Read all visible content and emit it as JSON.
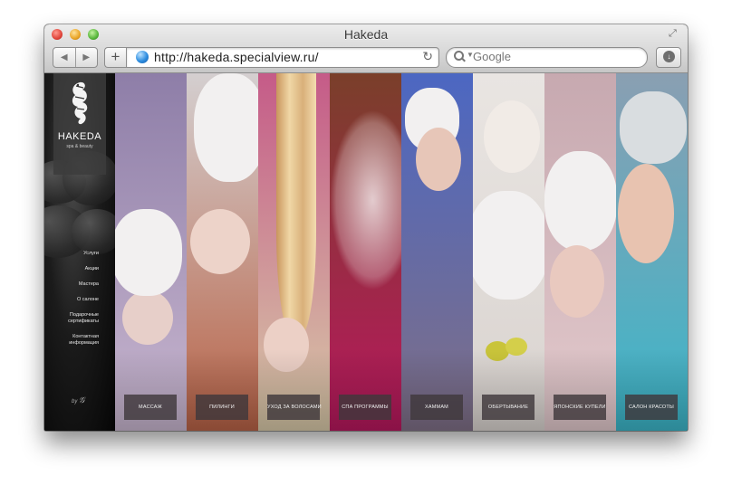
{
  "window": {
    "title": "Hakeda"
  },
  "toolbar": {
    "back_icon": "◀",
    "forward_icon": "▶",
    "add_icon": "+",
    "url": "http://hakeda.specialview.ru/",
    "reload_icon": "↻",
    "search_placeholder": "Google"
  },
  "sidebar": {
    "logo_name": "HAKEDA",
    "logo_sub": "spa & beauty",
    "menu": [
      "Услуги",
      "Акции",
      "Мастера",
      "О салоне",
      "Подарочные сертификаты",
      "Контактная информация"
    ],
    "credit": "by"
  },
  "panels": [
    {
      "label": "МАССАЖ",
      "color_top": "#8e7ea8",
      "color_bottom": "#c8b6cf"
    },
    {
      "label": "ПИЛИНГИ",
      "color_top": "#d4cfd0",
      "color_bottom": "#b86246"
    },
    {
      "label": "УХОД ЗА ВОЛОСАМИ",
      "color_top": "#c55b88",
      "color_bottom": "#d8c9a8"
    },
    {
      "label": "СПА ПРОГРАММЫ",
      "color_top": "#7a3f2a",
      "color_bottom": "#b8185e"
    },
    {
      "label": "ХАММАМ",
      "color_top": "#4c67c2",
      "color_bottom": "#7f6f86"
    },
    {
      "label": "ОБЕРТЫВАНИЕ",
      "color_top": "#e9e5e2",
      "color_bottom": "#d9d3cf"
    },
    {
      "label": "ЯПОНСКИЕ КУПЕЛИ",
      "color_top": "#c7a9b0",
      "color_bottom": "#e2c9cc"
    },
    {
      "label": "САЛОН КРАСОТЫ",
      "color_top": "#8a9fb2",
      "color_bottom": "#3bb6c9"
    }
  ]
}
